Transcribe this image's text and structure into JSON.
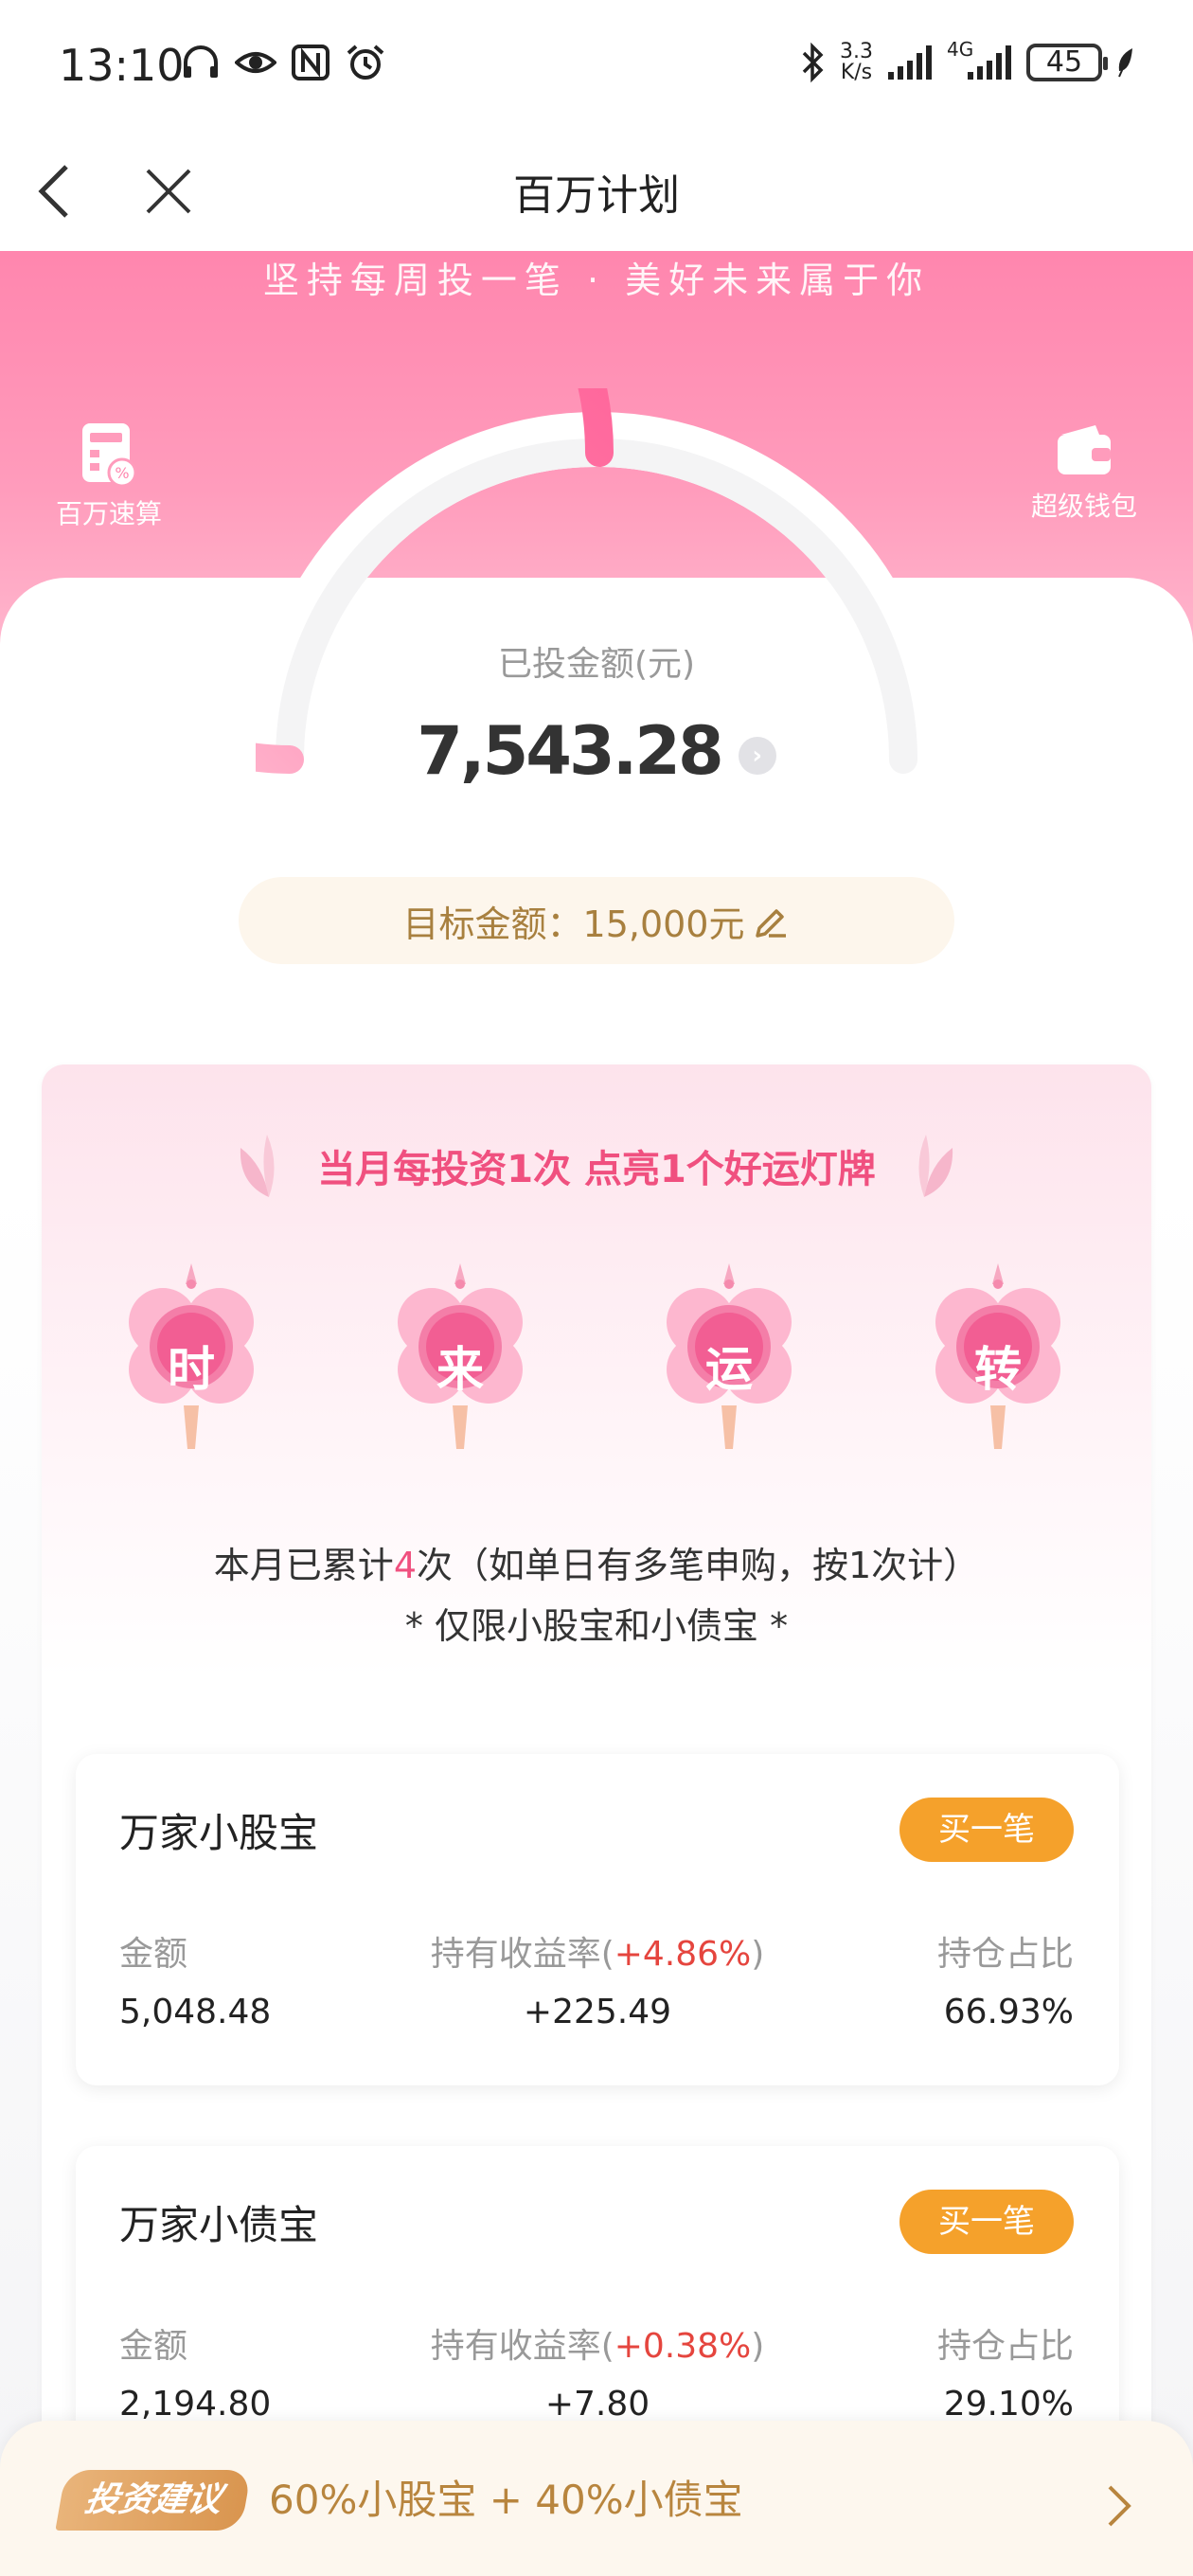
{
  "status_bar": {
    "time": "13:10",
    "speed_value": "3.3",
    "speed_unit": "K/s",
    "network": "4G",
    "battery": "45"
  },
  "nav": {
    "title": "百万计划"
  },
  "hero": {
    "slogan": "坚持每周投一笔 · 美好未来属于你",
    "tool_left": "百万速算",
    "tool_right": "超级钱包",
    "invested_label": "已投金额(元)",
    "invested_value": "7,543.28",
    "invested_progress": 0.5029,
    "target_label": "目标金额：15,000元"
  },
  "promo": {
    "title": "当月每投资1次 点亮1个好运灯牌",
    "lanterns": [
      "时",
      "来",
      "运",
      "转"
    ],
    "count_prefix": "本月已累计",
    "count_value": "4",
    "count_suffix": "次（如单日有多笔申购，按1次计）",
    "limit_note": "* 仅限小股宝和小债宝 *"
  },
  "funds": [
    {
      "name": "万家小股宝",
      "buy_label": "买一笔",
      "amount_label": "金额",
      "amount": "5,048.48",
      "yield_label_prefix": "持有收益率(",
      "yield_rate": "+4.86%",
      "yield_label_suffix": ")",
      "yield_value": "+225.49",
      "ratio_label": "持仓占比",
      "ratio": "66.93%"
    },
    {
      "name": "万家小债宝",
      "buy_label": "买一笔",
      "amount_label": "金额",
      "amount": "2,194.80",
      "yield_label_prefix": "持有收益率(",
      "yield_rate": "+0.38%",
      "yield_label_suffix": ")",
      "yield_value": "+7.80",
      "ratio_label": "持仓占比",
      "ratio": "29.10%"
    }
  ],
  "advice": {
    "tag": "投资建议",
    "text": "60%小股宝 + 40%小债宝"
  },
  "colors": {
    "pink": "#ff86ae",
    "accent_pink": "#f0507f",
    "orange": "#f5a12b",
    "red": "#e5453e",
    "gold": "#b8853e"
  }
}
